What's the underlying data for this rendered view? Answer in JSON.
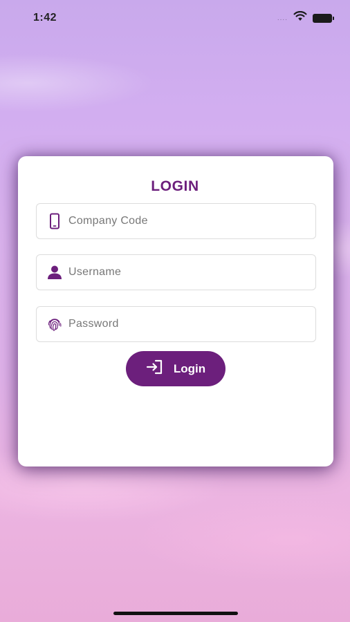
{
  "status_bar": {
    "time": "1:42",
    "signal": "....",
    "battery_icon": "battery-icon",
    "wifi_icon": "wifi-icon"
  },
  "login_card": {
    "title": "LOGIN",
    "fields": {
      "company_code": {
        "placeholder": "Company Code",
        "value": "",
        "icon": "phone-icon"
      },
      "username": {
        "placeholder": "Username",
        "value": "",
        "icon": "user-icon"
      },
      "password": {
        "placeholder": "Password",
        "value": "",
        "icon": "fingerprint-icon"
      }
    },
    "login_button": {
      "label": "Login",
      "icon": "login-arrow-icon"
    }
  },
  "colors": {
    "accent": "#6c1f7c",
    "card_bg": "#ffffff",
    "field_border": "#dcdcdc"
  }
}
